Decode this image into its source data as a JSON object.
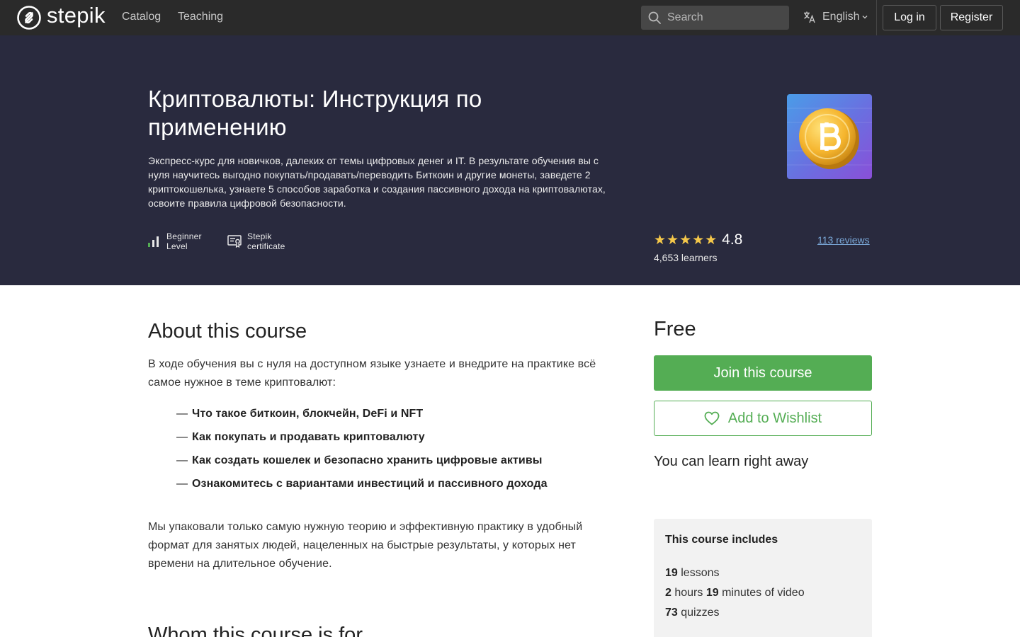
{
  "nav": {
    "logo_text": "stepik",
    "catalog": "Catalog",
    "teaching": "Teaching",
    "search_placeholder": "Search",
    "language": "English",
    "login": "Log in",
    "register": "Register"
  },
  "hero": {
    "title": "Криптовалюты: Инструкция по применению",
    "summary": "Экспресс-курс для новичков, далеких от темы цифровых денег и IT. В результате обучения вы с нуля научитесь выгодно покупать/продавать/переводить Биткоин и другие монеты, заведете 2 криптокошелька, узнаете 5 способов заработка и создания пассивного дохода на криптовалютах, освоите правила цифровой безопасности.",
    "level_line1": "Beginner",
    "level_line2": "Level",
    "cert_line1": "Stepik",
    "cert_line2": "certificate",
    "stars": "★★★★★",
    "rating": "4.8",
    "learners": "4,653 learners",
    "reviews": "113 reviews"
  },
  "about": {
    "heading": "About this course",
    "intro": "В ходе обучения вы с нуля на доступном языке узнаете и внедрите на практике всё самое нужное в теме криптовалют:",
    "bullets": [
      "Что такое биткоин, блокчейн, DeFi и NFT",
      "Как покупать и продавать криптовалюту",
      "Как создать кошелек и безопасно хранить цифровые активы",
      "Ознакомитесь с вариантами инвестиций и пассивного дохода"
    ],
    "dash": "—",
    "outro": "Мы упаковали только самую нужную теорию и эффективную практику в удобный формат для занятых людей, нацеленных на быстрые результаты, у которых нет времени на длительное обучение.",
    "whom_heading": "Whom this course is for"
  },
  "sidebar": {
    "price": "Free",
    "join": "Join this course",
    "wishlist": "Add to Wishlist",
    "learn_now": "You can learn right away",
    "includes_title": "This course includes",
    "lessons_num": "19",
    "lessons_label": "lessons",
    "hours_num": "2",
    "hours_label": "hours",
    "minutes_num": "19",
    "minutes_label": "minutes of video",
    "quizzes_num": "73",
    "quizzes_label": "quizzes"
  },
  "colors": {
    "nav_bg": "#2a2a2a",
    "hero_bg": "#292a3e",
    "accent_green": "#54ad54",
    "star_yellow": "#f5c84a",
    "link_blue": "#7aa8d8"
  },
  "icons": {
    "logo": "stepik-logo-icon",
    "search": "search-icon",
    "language": "translate-icon",
    "level": "level-bars-icon",
    "certificate": "certificate-icon",
    "wishlist": "heart-icon",
    "cover": "bitcoin-coin-cover"
  }
}
